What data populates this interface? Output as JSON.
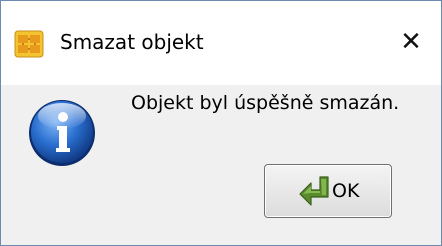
{
  "window": {
    "title": "Smazat objekt",
    "close_symbol": "✕",
    "app_icon": "app-icon"
  },
  "dialog": {
    "icon": "info-icon",
    "message": "Objekt byl úspěšně smazán.",
    "ok_label": "OK",
    "ok_icon": "return-arrow-icon"
  },
  "colors": {
    "content_background": "#f0f0f0",
    "info_icon_blue": "#1d62c4",
    "app_icon_yellow": "#f4c430",
    "ok_arrow_green": "#5a8a2e"
  }
}
